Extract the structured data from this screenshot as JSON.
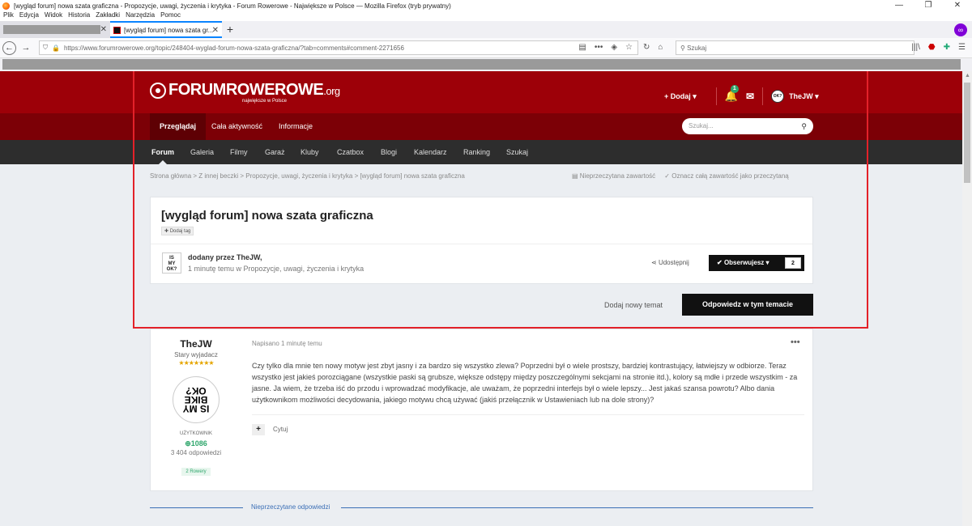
{
  "browser": {
    "window_title": "[wygląd forum] nowa szata graficzna - Propozycje, uwagi, życzenia i krytyka - Forum Rowerowe - Największe w Polsce — Mozilla Firefox (tryb prywatny)",
    "menu": [
      "Plik",
      "Edycja",
      "Widok",
      "Historia",
      "Zakładki",
      "Narzędzia",
      "Pomoc"
    ],
    "tab_active_label": "[wygląd forum] nowa szata gr...",
    "url": "https://www.forumrowerowe.org/topic/248404-wyglad-forum-nowa-szata-graficzna/?tab=comments#comment-2271656",
    "search_placeholder": "Szukaj"
  },
  "site": {
    "logo_main": "FORUMROWEROWE",
    "logo_suffix": ".org",
    "logo_tagline": "największe w Polsce",
    "add_label": "Dodaj",
    "notif_count": "1",
    "user_name": "TheJW",
    "subtabs": [
      "Przeglądaj",
      "Cała aktywność",
      "Informacje"
    ],
    "search_placeholder": "Szukaj...",
    "nav": [
      "Forum",
      "Galeria",
      "Filmy",
      "Garaż",
      "Kluby",
      "Czatbox",
      "Blogi",
      "Kalendarz",
      "Ranking",
      "Szukaj"
    ]
  },
  "breadcrumb": {
    "path": "Strona główna > Z innej beczki > Propozycje, uwagi, życzenia i krytyka > [wygląd forum] nowa szata graficzna",
    "unread": "Nieprzeczytana zawartość",
    "mark_read": "Oznacz całą zawartość jako przeczytaną"
  },
  "topic": {
    "title": "[wygląd forum] nowa szata graficzna",
    "add_tag": "Dodaj tag",
    "author_line": "dodany przez TheJW,",
    "meta_line": "1 minutę temu w Propozycje, uwagi, życzenia i krytyka",
    "share": "Udostępnij",
    "follow": "Obserwujesz",
    "follow_count": "2",
    "new_topic": "Dodaj nowy temat",
    "reply": "Odpowiedz w tym temacie"
  },
  "post": {
    "author": "TheJW",
    "rank": "Stary wyjadacz",
    "stars": "★★★★★★★",
    "avatar_text": "IS MY BIKE OK?",
    "role": "UŻYTKOWNIK",
    "reputation": "1086",
    "replies": "3 404 odpowiedzi",
    "tag": "2 Rowery",
    "date": "Napisano 1 minutę temu",
    "body": "Czy tylko dla mnie ten nowy motyw jest zbyt jasny i za bardzo się wszystko zlewa? Poprzedni był o wiele prostszy, bardziej kontrastujący, łatwiejszy w odbiorze. Teraz wszystko jest jakieś porozciągane (wszystkie paski są grubsze, większe odstępy między poszczególnymi sekcjami na stronie itd.), kolory są mdłe i przede wszystkim - za jasne. Ja wiem, że trzeba iść do przodu i wprowadzać modyfikacje, ale uważam, że poprzedni interfejs był o wiele lepszy... Jest jakaś szansa powrotu? Albo dania użytkownikom możliwości decydowania, jakiego motywu chcą używać (jakiś przełącznik w Ustawieniach lub na dole strony)?",
    "quote": "Cytuj"
  },
  "unread_replies": "Nieprzeczytane odpowiedzi",
  "colors": {
    "header": "#9d0008",
    "subheader": "#7c0006",
    "nav": "#2d2d2d",
    "highlight_box": "#e32129",
    "accent_green": "#2ea66b"
  }
}
